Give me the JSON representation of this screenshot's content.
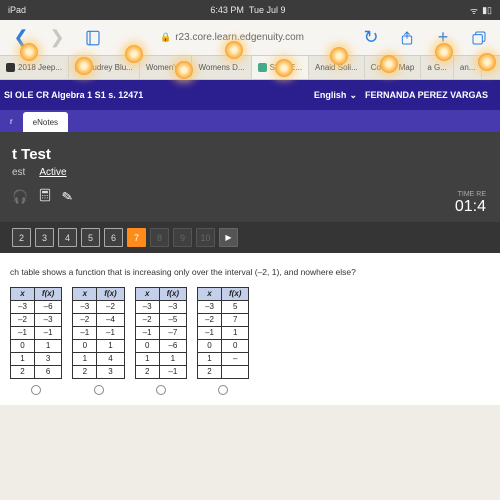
{
  "statusbar": {
    "carrier": "iPad",
    "time": "6:43 PM",
    "date": "Tue Jul 9"
  },
  "safari": {
    "url_domain": "r23.core.learn.edgenuity.com",
    "tabs": [
      {
        "label": "2018 Jeep..."
      },
      {
        "label": "Audrey Blu..."
      },
      {
        "label": "Women's..."
      },
      {
        "label": "Womens D..."
      },
      {
        "label": "SI OLE...",
        "active": true
      },
      {
        "label": "Anaid Soli..."
      },
      {
        "label": "Course Map"
      },
      {
        "label": "a G..."
      },
      {
        "label": "an..."
      }
    ]
  },
  "course": {
    "title": "SI OLE CR Algebra 1 S1 s. 12471",
    "language": "English",
    "student": "FERNANDA PEREZ VARGAS",
    "subtabs": {
      "a": "r",
      "b": "eNotes"
    }
  },
  "test": {
    "heading": "t Test",
    "tab_a": "est",
    "tab_b": "Active",
    "timer_label": "TIME RE",
    "timer_value": "01:4",
    "qnav": [
      "2",
      "3",
      "4",
      "5",
      "6",
      "7",
      "8",
      "9",
      "10",
      "▶"
    ],
    "current_q": "7",
    "question": "ch table shows a function that is increasing only over the interval (–2, 1), and nowhere else?"
  },
  "tables": [
    {
      "head": [
        "x",
        "f(x)"
      ],
      "rows": [
        [
          "–3",
          "–6"
        ],
        [
          "–2",
          "–3"
        ],
        [
          "–1",
          "–1"
        ],
        [
          "0",
          "1"
        ],
        [
          "1",
          "3"
        ],
        [
          "2",
          "6"
        ]
      ]
    },
    {
      "head": [
        "x",
        "f(x)"
      ],
      "rows": [
        [
          "–3",
          "–2"
        ],
        [
          "–2",
          "–4"
        ],
        [
          "–1",
          "–1"
        ],
        [
          "0",
          "1"
        ],
        [
          "1",
          "4"
        ],
        [
          "2",
          "3"
        ]
      ]
    },
    {
      "head": [
        "x",
        "f(x)"
      ],
      "rows": [
        [
          "–3",
          "–3"
        ],
        [
          "–2",
          "–5"
        ],
        [
          "–1",
          "–7"
        ],
        [
          "0",
          "–6"
        ],
        [
          "1",
          "1"
        ],
        [
          "2",
          "–1"
        ]
      ]
    },
    {
      "head": [
        "x",
        "f(x)"
      ],
      "rows": [
        [
          "–3",
          "5"
        ],
        [
          "–2",
          "7"
        ],
        [
          "–1",
          "1"
        ],
        [
          "0",
          "0"
        ],
        [
          "1",
          "–"
        ],
        [
          "2",
          ""
        ]
      ]
    }
  ],
  "colors": {
    "accent": "#ff8c1a",
    "brand": "#2b1f8f"
  }
}
